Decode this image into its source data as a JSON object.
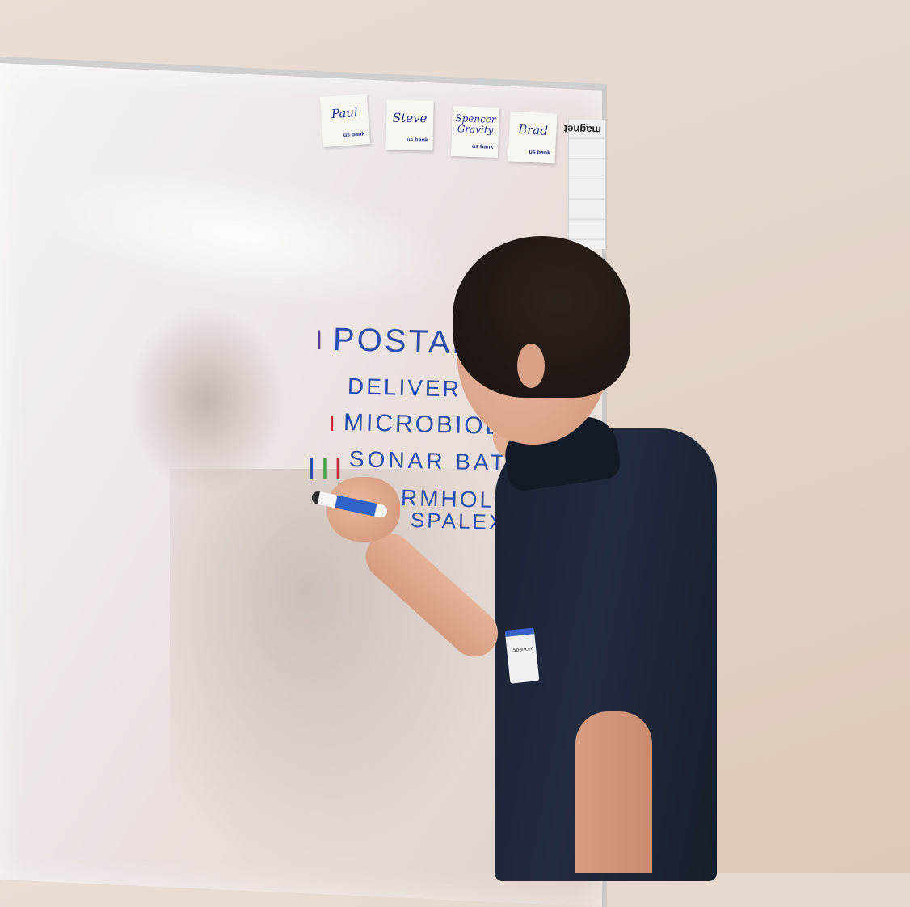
{
  "scene": {
    "description_label": ""
  },
  "sticky_notes": [
    {
      "name": "Paul",
      "logo": "us bank"
    },
    {
      "name": "Steve",
      "logo": "us bank"
    },
    {
      "name": "Spencer Gravity",
      "logo": "us bank"
    },
    {
      "name": "Brad",
      "logo": "us bank"
    }
  ],
  "magnet_brand": "magnet",
  "whiteboard_lines": [
    {
      "tally": "I",
      "text": "POSTAPOC"
    },
    {
      "tally": "",
      "text": "DELIVER TH"
    },
    {
      "tally": "I",
      "text": "MICROBIOLO"
    },
    {
      "tally": "I I I",
      "text": "SONAR BATS"
    },
    {
      "tally": "",
      "text": "RMHOLES /"
    },
    {
      "tally": "",
      "text": "SPALEX / co"
    }
  ],
  "name_tag_text": "Spencer",
  "colors": {
    "ink_blue": "#2b4da8",
    "ink_purple": "#5a3aa8",
    "ink_red": "#c8283a",
    "ink_green": "#4ea24a",
    "shirt": "#1f2838"
  }
}
